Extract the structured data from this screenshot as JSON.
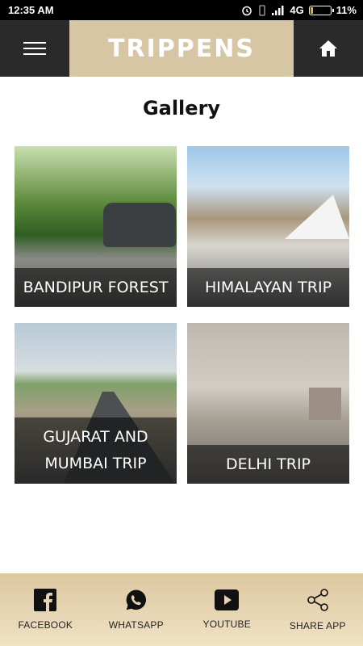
{
  "status_bar": {
    "time": "12:35 AM",
    "network": "4G",
    "battery": "11%",
    "battery_level": 0.11
  },
  "header": {
    "brand": "TRIPPENS",
    "menu_icon": "hamburger-menu-icon",
    "home_icon": "home-icon"
  },
  "gallery": {
    "title": "Gallery",
    "items": [
      {
        "caption": "BANDIPUR FOREST"
      },
      {
        "caption": "HIMALAYAN TRIP"
      },
      {
        "caption_line1": "GUJARAT AND",
        "caption_line2": "MUMBAI TRIP"
      },
      {
        "caption": "DELHI TRIP"
      }
    ]
  },
  "footer": {
    "items": [
      {
        "label": "FACEBOOK",
        "icon": "facebook-icon"
      },
      {
        "label": "WHATSAPP",
        "icon": "whatsapp-icon"
      },
      {
        "label": "YOUTUBE",
        "icon": "youtube-icon"
      },
      {
        "label": "SHARE APP",
        "icon": "share-icon"
      }
    ]
  },
  "colors": {
    "header_dark": "#2a2a2a",
    "brand_bg": "#d7c6a4",
    "footer_bg": "#e6d4b0"
  }
}
